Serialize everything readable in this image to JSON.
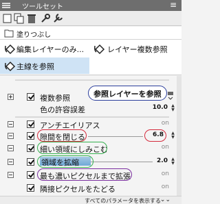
{
  "window": {
    "title": "ツールセット",
    "close": "≡"
  },
  "current_tool": {
    "label": "塗りつぶし",
    "icon": "bucket-icon"
  },
  "subtools": [
    {
      "label": "編集レイヤーのみ...",
      "icon": "bucket-icon"
    },
    {
      "label": "レイヤー複数参照",
      "icon": "bucket-icon"
    },
    {
      "label": "主線を参照",
      "icon": "bucket-icon"
    }
  ],
  "properties": {
    "reference": {
      "label": "複数参照",
      "callout": "参照レイヤーを参照"
    },
    "tolerance": {
      "label": "色の許容誤差",
      "value": "10.0"
    },
    "antialias": {
      "label": "アンチエイリアス",
      "state": "on"
    },
    "close_gap": {
      "label": "隙間を閉じる",
      "value": "6.8"
    },
    "fill_small": {
      "label": "細い領域にしみこむ",
      "state": "on"
    },
    "expand": {
      "label": "領域を拡縮",
      "value": "2.0"
    },
    "darkest": {
      "label": "最も濃いピクセルまで拡張",
      "state": "on"
    },
    "adjacent": {
      "label": "隣接ピクセルをたどる",
      "state": "on"
    }
  },
  "footer": {
    "text": "すべてのパラメータを表示する",
    "more": "⌄⌄"
  },
  "colors": {
    "red": "#d42a3c",
    "green": "#36b14f",
    "purple": "#7a2e9f",
    "navy": "#2a3d9b",
    "active": "#cfe3f5"
  }
}
